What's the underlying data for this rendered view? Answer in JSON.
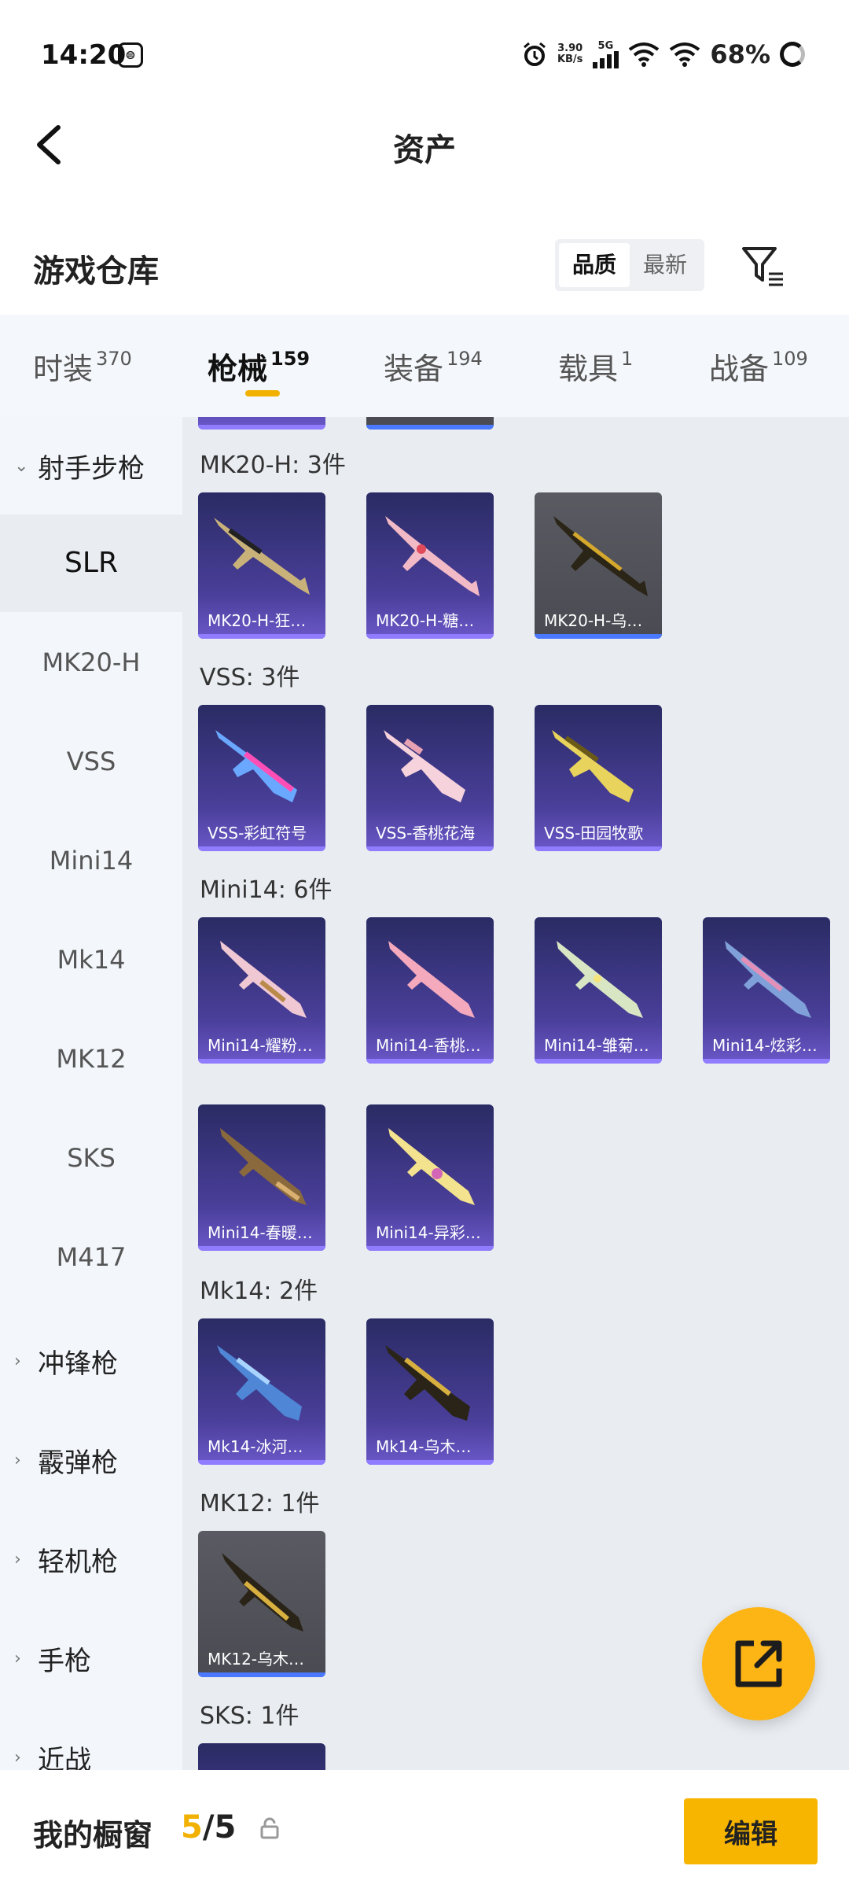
{
  "status_bar": {
    "time": "14:20",
    "speed_value": "3.90",
    "speed_unit": "KB/s",
    "network": "5G",
    "battery": "68%"
  },
  "header": {
    "title": "资产"
  },
  "warehouse": {
    "title": "游戏仓库",
    "sort_options": [
      "品质",
      "最新"
    ],
    "active_sort": "品质"
  },
  "tabs": [
    {
      "label": "时装",
      "count": "370"
    },
    {
      "label": "枪械",
      "count": "159",
      "active": true
    },
    {
      "label": "装备",
      "count": "194"
    },
    {
      "label": "载具",
      "count": "1"
    },
    {
      "label": "战备",
      "count": "109"
    }
  ],
  "sidebar": {
    "expanded_group": "射手步枪",
    "items": [
      "SLR",
      "MK20-H",
      "VSS",
      "Mini14",
      "Mk14",
      "MK12",
      "SKS",
      "M417"
    ],
    "active_item": "SLR",
    "collapsed_groups": [
      "冲锋枪",
      "霰弹枪",
      "轻机枪",
      "手枪",
      "近战"
    ]
  },
  "groups": [
    {
      "label": "MK20-H: 3件",
      "items": [
        {
          "name": "MK20-H-狂…",
          "style": "purple"
        },
        {
          "name": "MK20-H-糖…",
          "style": "purple"
        },
        {
          "name": "MK20-H-乌…",
          "style": "gray"
        }
      ]
    },
    {
      "label": "VSS: 3件",
      "items": [
        {
          "name": "VSS-彩虹符号",
          "style": "purple"
        },
        {
          "name": "VSS-香桃花海",
          "style": "purple"
        },
        {
          "name": "VSS-田园牧歌",
          "style": "purple"
        }
      ]
    },
    {
      "label": "Mini14: 6件",
      "items": [
        {
          "name": "Mini14-耀粉…",
          "style": "purple"
        },
        {
          "name": "Mini14-香桃…",
          "style": "purple"
        },
        {
          "name": "Mini14-雏菊…",
          "style": "purple"
        },
        {
          "name": "Mini14-炫彩…",
          "style": "purple"
        },
        {
          "name": "Mini14-春暖…",
          "style": "purple"
        },
        {
          "name": "Mini14-异彩…",
          "style": "purple"
        }
      ]
    },
    {
      "label": "Mk14: 2件",
      "items": [
        {
          "name": "Mk14-冰河…",
          "style": "purple"
        },
        {
          "name": "Mk14-乌木…",
          "style": "purple"
        }
      ]
    },
    {
      "label": "MK12: 1件",
      "items": [
        {
          "name": "MK12-乌木…",
          "style": "gray"
        }
      ]
    },
    {
      "label": "SKS: 1件",
      "items": []
    }
  ],
  "showcase": {
    "label": "我的橱窗",
    "current": "5",
    "separator": "/",
    "total": "5",
    "edit_label": "编辑"
  },
  "colors": {
    "accent": "#f7b500",
    "card_purple": "#4a3f9a",
    "card_gray": "#55565c"
  }
}
